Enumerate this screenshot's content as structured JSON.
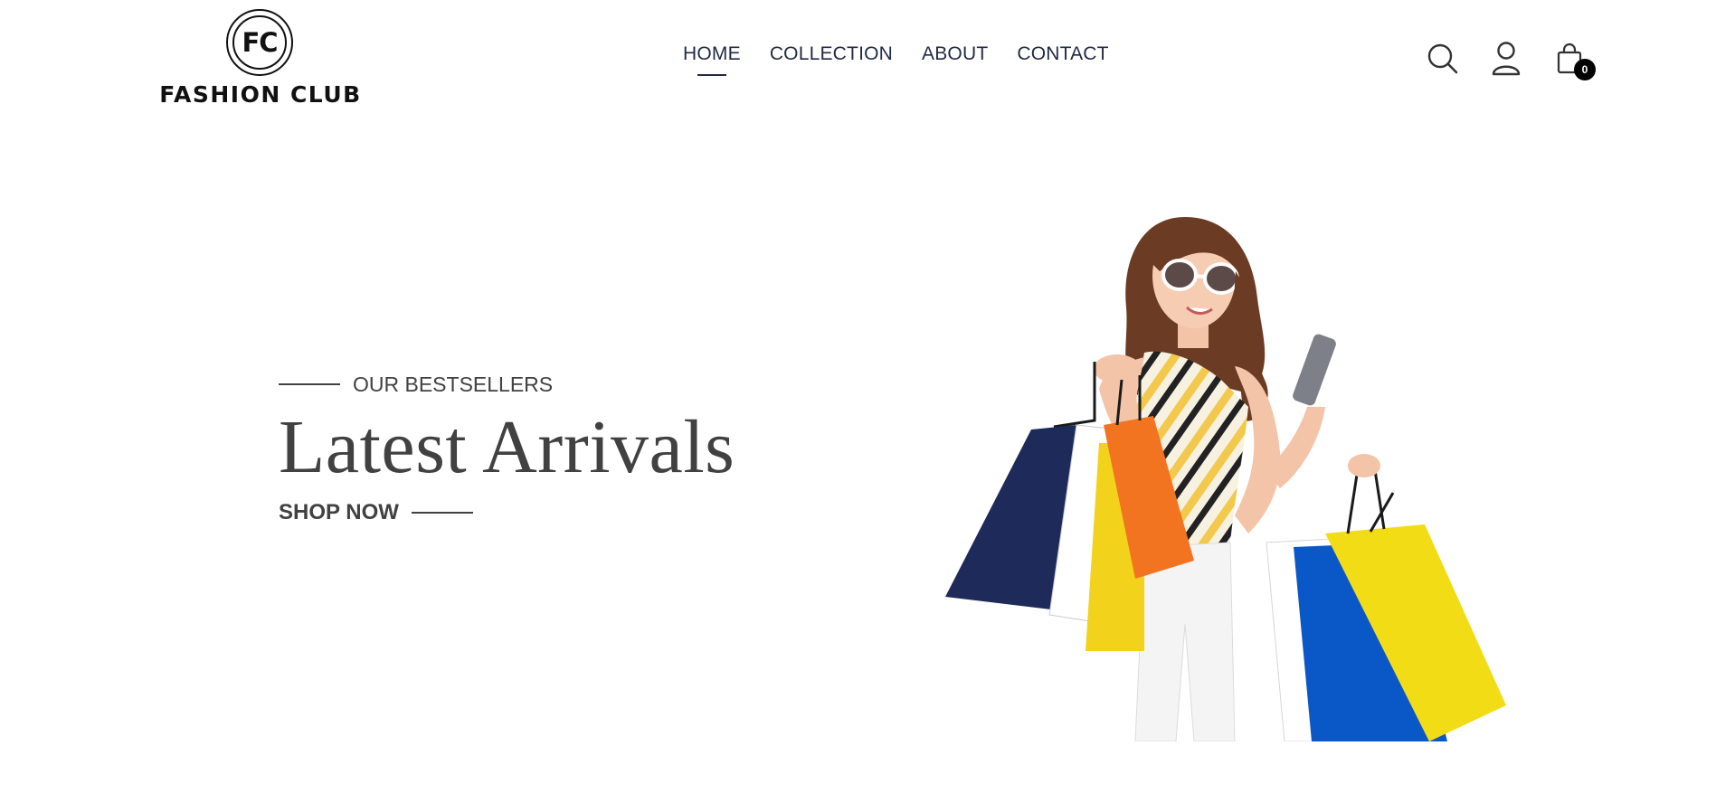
{
  "brand": {
    "initials": "FC",
    "name": "FASHION CLUB"
  },
  "nav": {
    "items": [
      {
        "label": "HOME",
        "active": true
      },
      {
        "label": "COLLECTION",
        "active": false
      },
      {
        "label": "ABOUT",
        "active": false
      },
      {
        "label": "CONTACT",
        "active": false
      }
    ]
  },
  "header_icons": {
    "search": "search-icon",
    "account": "user-icon",
    "cart": "shopping-bag-icon",
    "cart_count": "0"
  },
  "hero": {
    "eyebrow": "OUR BESTSELLERS",
    "title": "Latest Arrivals",
    "cta_label": "SHOP NOW",
    "image": "woman-with-shopping-bags"
  },
  "colors": {
    "text": "#414141",
    "nav": "#1f2a44",
    "badge": "#000000",
    "background": "#ffffff"
  }
}
